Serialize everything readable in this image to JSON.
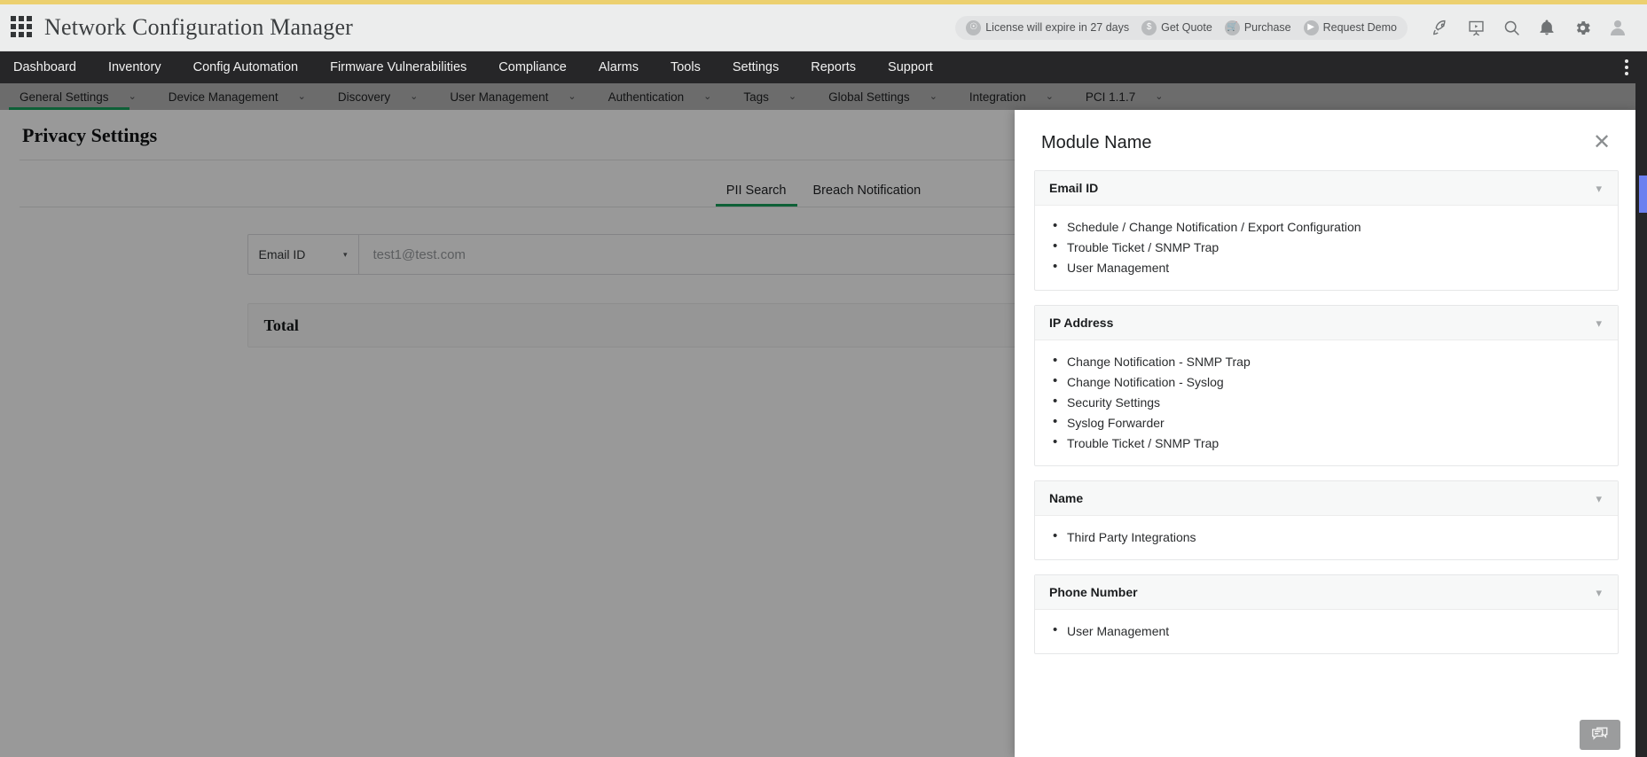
{
  "app": {
    "title": "Network Configuration Manager",
    "launcher_icon": "apps-grid-icon",
    "accent_color": "#ecd06f"
  },
  "header": {
    "license": {
      "badge_icon": "license-medal-icon",
      "text": "License will expire in 27 days"
    },
    "actions": [
      {
        "icon": "dollar-icon",
        "label": "Get Quote"
      },
      {
        "icon": "cart-icon",
        "label": "Purchase"
      },
      {
        "icon": "demo-screen-icon",
        "label": "Request Demo"
      }
    ],
    "icons": [
      {
        "name": "rocket-icon",
        "title": "What's New"
      },
      {
        "name": "presentation-icon",
        "title": "Demo"
      },
      {
        "name": "search-icon",
        "title": "Search"
      },
      {
        "name": "bell-icon",
        "title": "Notifications"
      },
      {
        "name": "gear-icon",
        "title": "Settings"
      },
      {
        "name": "user-avatar-icon",
        "title": "Account"
      }
    ]
  },
  "mainnav": {
    "items": [
      {
        "label": "Dashboard"
      },
      {
        "label": "Inventory"
      },
      {
        "label": "Config Automation"
      },
      {
        "label": "Firmware Vulnerabilities"
      },
      {
        "label": "Compliance"
      },
      {
        "label": "Alarms"
      },
      {
        "label": "Tools"
      },
      {
        "label": "Settings"
      },
      {
        "label": "Reports"
      },
      {
        "label": "Support"
      }
    ],
    "overflow_icon": "kebab-menu-icon"
  },
  "subnav": {
    "active_index": 0,
    "items": [
      {
        "label": "General Settings",
        "caret": "⌄"
      },
      {
        "label": "Device Management",
        "caret": "⌄"
      },
      {
        "label": "Discovery",
        "caret": "⌄"
      },
      {
        "label": "User Management",
        "caret": "⌄"
      },
      {
        "label": "Authentication",
        "caret": "⌄"
      },
      {
        "label": "Tags",
        "caret": "⌄"
      },
      {
        "label": "Global Settings",
        "caret": "⌄"
      },
      {
        "label": "Integration",
        "caret": "⌄"
      },
      {
        "label": "PCI 1.1.7",
        "caret": "⌄"
      }
    ]
  },
  "page": {
    "title": "Privacy Settings",
    "tabs": [
      {
        "label": "PII Search",
        "active": true
      },
      {
        "label": "Breach Notification",
        "active": false
      }
    ],
    "search": {
      "selected_type": "Email ID",
      "caret": "▾",
      "placeholder": "test1@test.com",
      "value": ""
    },
    "total_label": "Total"
  },
  "panel": {
    "title": "Module Name",
    "close_icon": "close-icon",
    "chevron_icon": "chevron-down-icon",
    "sections": [
      {
        "title": "Email ID",
        "items": [
          "Schedule / Change Notification / Export Configuration",
          "Trouble Ticket / SNMP Trap",
          "User Management"
        ]
      },
      {
        "title": "IP Address",
        "items": [
          "Change Notification - SNMP Trap",
          "Change Notification - Syslog",
          "Security Settings",
          "Syslog Forwarder",
          "Trouble Ticket / SNMP Trap"
        ]
      },
      {
        "title": "Name",
        "items": [
          "Third Party Integrations"
        ]
      },
      {
        "title": "Phone Number",
        "items": [
          "User Management"
        ]
      }
    ]
  },
  "widgets": {
    "chat_icon": "chat-bubbles-icon",
    "feedback_tab": "feedback-tab"
  }
}
